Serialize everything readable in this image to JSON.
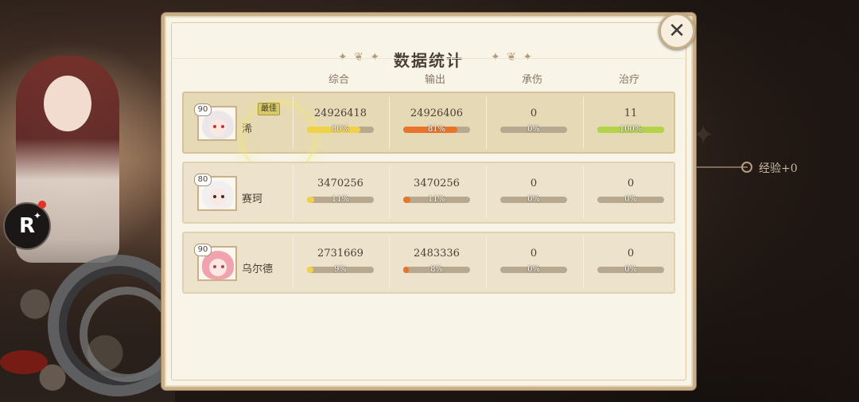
{
  "panel": {
    "title": "数据统计",
    "columns": [
      "综合",
      "输出",
      "承伤",
      "治疗"
    ],
    "mvp_label": "最佳"
  },
  "background": {
    "exp_text": "经验+0",
    "r_button": "R"
  },
  "colors": {
    "overall_bar": "#f0d24a",
    "output_bar": "#e8742c",
    "heal_bar": "#b2d34a",
    "track": "#b6a98f"
  },
  "players": [
    {
      "name": "浠",
      "level": "90",
      "mvp": true,
      "hair_color": "#ebe6ea",
      "eye_color": "#c0383a",
      "stats": [
        {
          "value": "24926418",
          "percent_label": "80%",
          "fill": 0.8,
          "type": "overall"
        },
        {
          "value": "24926406",
          "percent_label": "81%",
          "fill": 0.81,
          "type": "output"
        },
        {
          "value": "0",
          "percent_label": "0%",
          "fill": 0.0,
          "type": "tank"
        },
        {
          "value": "11",
          "percent_label": "100%",
          "fill": 1.0,
          "type": "heal"
        }
      ]
    },
    {
      "name": "赛珂",
      "level": "80",
      "mvp": false,
      "hair_color": "#f1eff0",
      "eye_color": "#303030",
      "stats": [
        {
          "value": "3470256",
          "percent_label": "11%",
          "fill": 0.11,
          "type": "overall"
        },
        {
          "value": "3470256",
          "percent_label": "11%",
          "fill": 0.11,
          "type": "output"
        },
        {
          "value": "0",
          "percent_label": "0%",
          "fill": 0.0,
          "type": "tank"
        },
        {
          "value": "0",
          "percent_label": "0%",
          "fill": 0.0,
          "type": "heal"
        }
      ]
    },
    {
      "name": "乌尔德",
      "level": "90",
      "mvp": false,
      "hair_color": "#f1a3ad",
      "eye_color": "#a0485a",
      "stats": [
        {
          "value": "2731669",
          "percent_label": "9%",
          "fill": 0.09,
          "type": "overall"
        },
        {
          "value": "2483336",
          "percent_label": "8%",
          "fill": 0.08,
          "type": "output"
        },
        {
          "value": "0",
          "percent_label": "0%",
          "fill": 0.0,
          "type": "tank"
        },
        {
          "value": "0",
          "percent_label": "0%",
          "fill": 0.0,
          "type": "heal"
        }
      ]
    }
  ]
}
